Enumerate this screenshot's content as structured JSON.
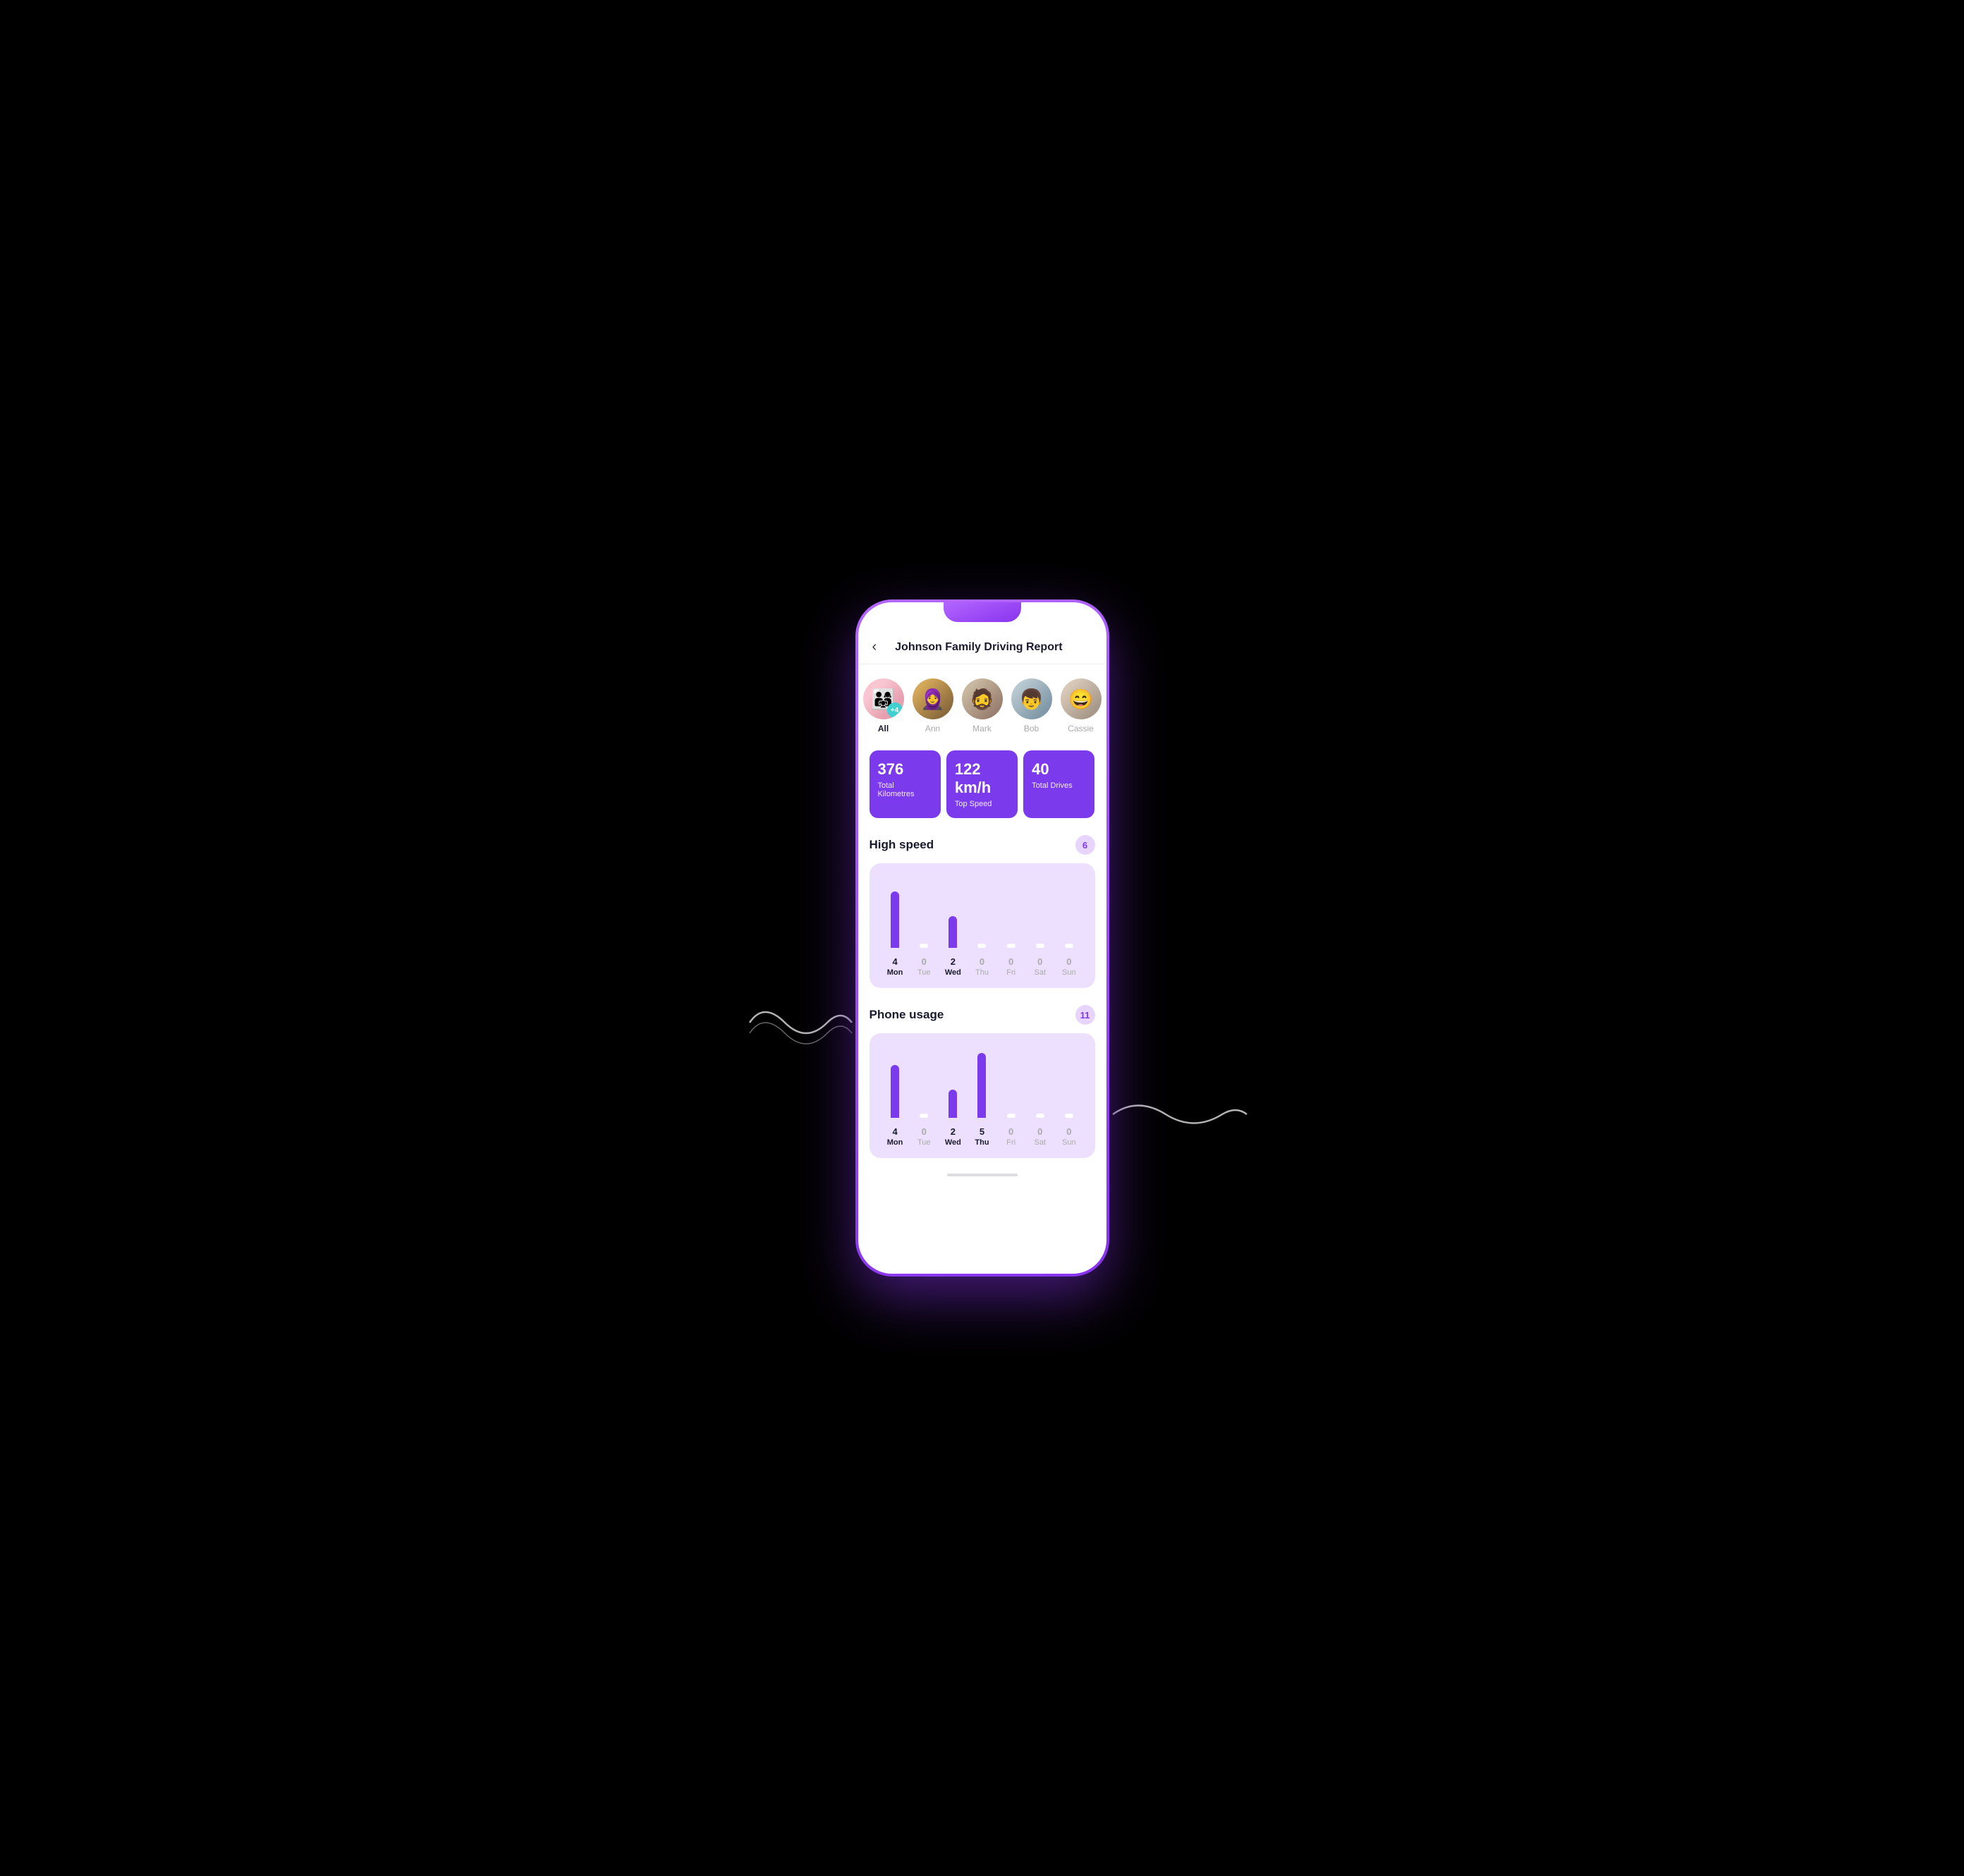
{
  "header": {
    "back_label": "‹",
    "title": "Johnson Family Driving Report"
  },
  "avatars": [
    {
      "id": "all",
      "label": "All",
      "selected": true,
      "badge": "+4",
      "face": "👨‍👩‍👧‍👦"
    },
    {
      "id": "ann",
      "label": "Ann",
      "selected": false,
      "face": "👩"
    },
    {
      "id": "mark",
      "label": "Mark",
      "selected": false,
      "face": "🧔"
    },
    {
      "id": "bob",
      "label": "Bob",
      "selected": false,
      "face": "👦"
    },
    {
      "id": "cassie",
      "label": "Cassie",
      "selected": false,
      "face": "😄"
    }
  ],
  "stats": [
    {
      "value": "376",
      "label": "Total Kilometres"
    },
    {
      "value": "122 km/h",
      "label": "Top Speed"
    },
    {
      "value": "40",
      "label": "Total Drives"
    }
  ],
  "sections": [
    {
      "id": "high-speed",
      "title": "High speed",
      "badge": "6",
      "chart": {
        "days": [
          {
            "name": "Mon",
            "value": 4,
            "active": true,
            "height": 80
          },
          {
            "name": "Tue",
            "value": 0,
            "active": false,
            "height": 0
          },
          {
            "name": "Wed",
            "value": 2,
            "active": true,
            "height": 45
          },
          {
            "name": "Thu",
            "value": 0,
            "active": false,
            "height": 0
          },
          {
            "name": "Fri",
            "value": 0,
            "active": false,
            "height": 0
          },
          {
            "name": "Sat",
            "value": 0,
            "active": false,
            "height": 0
          },
          {
            "name": "Sun",
            "value": 0,
            "active": false,
            "height": 0
          }
        ]
      }
    },
    {
      "id": "phone-usage",
      "title": "Phone usage",
      "badge": "11",
      "chart": {
        "days": [
          {
            "name": "Mon",
            "value": 4,
            "active": true,
            "height": 75
          },
          {
            "name": "Tue",
            "value": 0,
            "active": false,
            "height": 0
          },
          {
            "name": "Wed",
            "value": 2,
            "active": true,
            "height": 40
          },
          {
            "name": "Thu",
            "value": 5,
            "active": true,
            "height": 90
          },
          {
            "name": "Fri",
            "value": 0,
            "active": false,
            "height": 0
          },
          {
            "name": "Sat",
            "value": 0,
            "active": false,
            "height": 0
          },
          {
            "name": "Sun",
            "value": 0,
            "active": false,
            "height": 0
          }
        ]
      }
    }
  ]
}
